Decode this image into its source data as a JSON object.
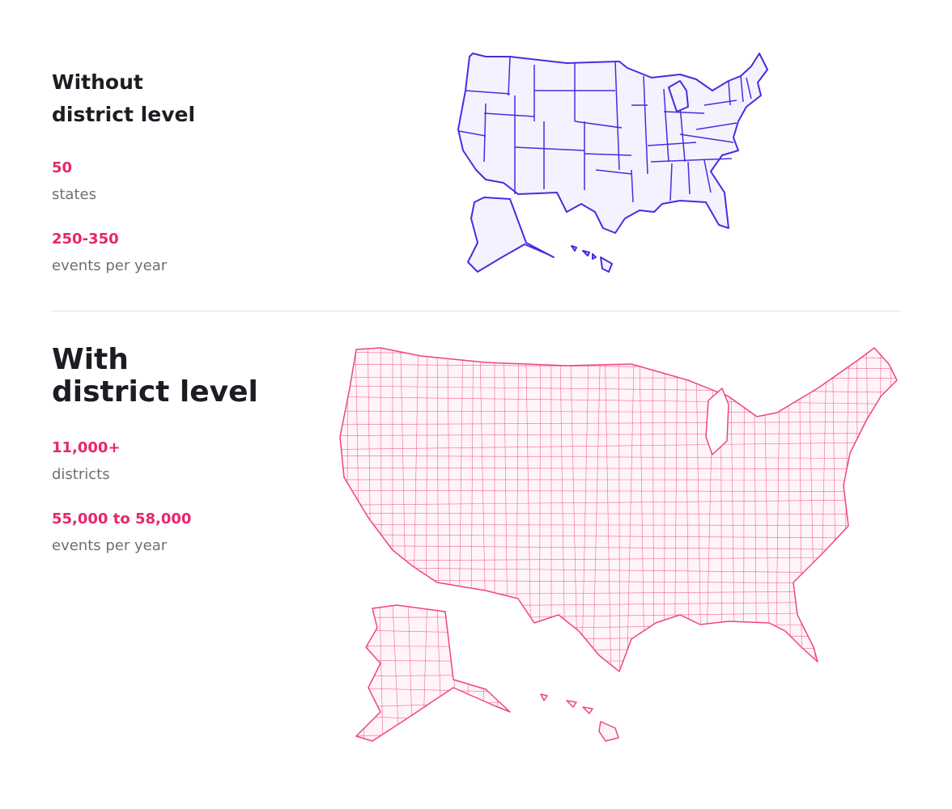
{
  "without": {
    "title_line1": "Without",
    "title_line2": "district level",
    "stat1_value": "50",
    "stat1_label": "states",
    "stat2_value": "250-350",
    "stat2_label": "events per year"
  },
  "with": {
    "title_line1": "With",
    "title_line2": "district level",
    "stat1_value": "11,000+",
    "stat1_label": "districts",
    "stat2_value": "55,000 to 58,000",
    "stat2_label": "events per year"
  },
  "colors": {
    "accent": "#e8256e",
    "state_map_stroke": "#4a2be0",
    "state_map_fill": "#f4f2ff",
    "district_map_stroke": "#f0457b",
    "district_map_fill": "#fff4f7"
  }
}
